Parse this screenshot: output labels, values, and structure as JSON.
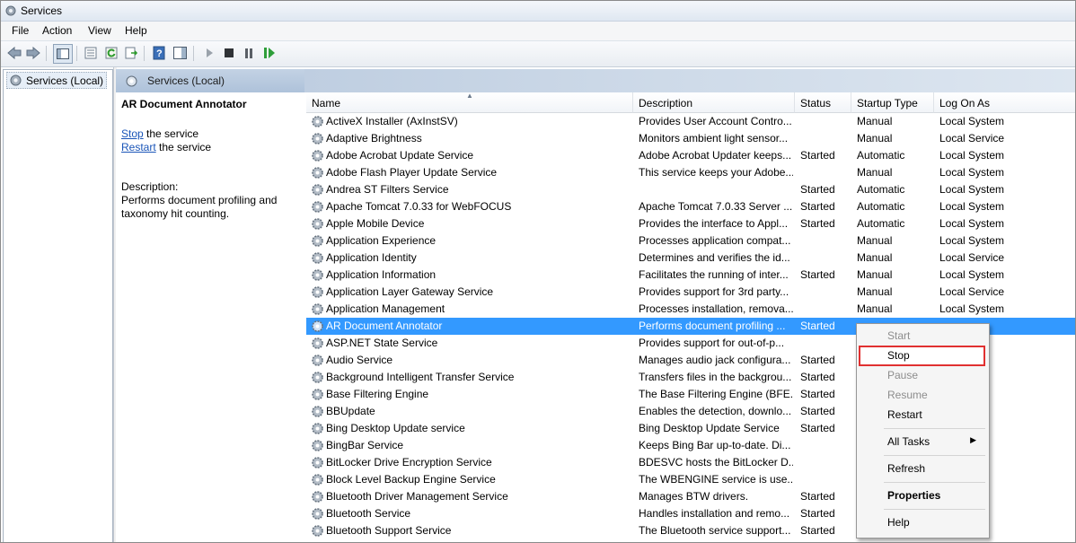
{
  "window": {
    "title": "Services"
  },
  "menu": [
    "File",
    "Action",
    "View",
    "Help"
  ],
  "toolbar": {
    "icons": [
      "back-arrow-icon",
      "forward-arrow-icon",
      "console-tree-icon",
      "properties-icon",
      "refresh-icon",
      "export-list-icon",
      "help-icon",
      "show-hide-action-pane-icon",
      "start-service-icon",
      "stop-service-icon",
      "pause-service-icon",
      "restart-service-icon"
    ]
  },
  "tree": {
    "item": "Services (Local)"
  },
  "pane": {
    "title": "Services (Local)"
  },
  "details": {
    "service_name": "AR Document Annotator",
    "stop_link": "Stop",
    "stop_suffix": " the service",
    "restart_link": "Restart",
    "restart_suffix": " the service",
    "description_label": "Description:",
    "description_text": "Performs document profiling and taxonomy hit counting."
  },
  "columns": [
    "Name",
    "Description",
    "Status",
    "Startup Type",
    "Log On As"
  ],
  "services": [
    {
      "name": "ActiveX Installer (AxInstSV)",
      "description": "Provides User Account Contro...",
      "status": "",
      "startup": "Manual",
      "logon": "Local System"
    },
    {
      "name": "Adaptive Brightness",
      "description": "Monitors ambient light sensor...",
      "status": "",
      "startup": "Manual",
      "logon": "Local Service"
    },
    {
      "name": "Adobe Acrobat Update Service",
      "description": "Adobe Acrobat Updater keeps...",
      "status": "Started",
      "startup": "Automatic",
      "logon": "Local System"
    },
    {
      "name": "Adobe Flash Player Update Service",
      "description": "This service keeps your Adobe...",
      "status": "",
      "startup": "Manual",
      "logon": "Local System"
    },
    {
      "name": "Andrea ST Filters Service",
      "description": "",
      "status": "Started",
      "startup": "Automatic",
      "logon": "Local System"
    },
    {
      "name": "Apache Tomcat 7.0.33 for WebFOCUS",
      "description": "Apache Tomcat 7.0.33 Server ...",
      "status": "Started",
      "startup": "Automatic",
      "logon": "Local System"
    },
    {
      "name": "Apple Mobile Device",
      "description": "Provides the interface to Appl...",
      "status": "Started",
      "startup": "Automatic",
      "logon": "Local System"
    },
    {
      "name": "Application Experience",
      "description": "Processes application compat...",
      "status": "",
      "startup": "Manual",
      "logon": "Local System"
    },
    {
      "name": "Application Identity",
      "description": "Determines and verifies the id...",
      "status": "",
      "startup": "Manual",
      "logon": "Local Service"
    },
    {
      "name": "Application Information",
      "description": "Facilitates the running of inter...",
      "status": "Started",
      "startup": "Manual",
      "logon": "Local System"
    },
    {
      "name": "Application Layer Gateway Service",
      "description": "Provides support for 3rd party...",
      "status": "",
      "startup": "Manual",
      "logon": "Local Service"
    },
    {
      "name": "Application Management",
      "description": "Processes installation, remova...",
      "status": "",
      "startup": "Manual",
      "logon": "Local System"
    },
    {
      "name": "AR Document Annotator",
      "description": "Performs document profiling ...",
      "status": "Started",
      "startup": "",
      "logon": "em",
      "selected": true
    },
    {
      "name": "ASP.NET State Service",
      "description": "Provides support for out-of-p...",
      "status": "",
      "startup": "",
      "logon": "ervice"
    },
    {
      "name": "Audio Service",
      "description": "Manages audio jack configura...",
      "status": "Started",
      "startup": "",
      "logon": "em"
    },
    {
      "name": "Background Intelligent Transfer Service",
      "description": "Transfers files in the backgrou...",
      "status": "Started",
      "startup": "",
      "logon": "em"
    },
    {
      "name": "Base Filtering Engine",
      "description": "The Base Filtering Engine (BFE...",
      "status": "Started",
      "startup": "",
      "logon": "ce"
    },
    {
      "name": "BBUpdate",
      "description": "Enables the detection, downlo...",
      "status": "Started",
      "startup": "",
      "logon": "em"
    },
    {
      "name": "Bing Desktop Update service",
      "description": "Bing Desktop Update Service",
      "status": "Started",
      "startup": "",
      "logon": "em"
    },
    {
      "name": "BingBar Service",
      "description": "Keeps Bing Bar up-to-date. Di...",
      "status": "",
      "startup": "",
      "logon": "em"
    },
    {
      "name": "BitLocker Drive Encryption Service",
      "description": "BDESVC hosts the BitLocker D...",
      "status": "",
      "startup": "",
      "logon": "em"
    },
    {
      "name": "Block Level Backup Engine Service",
      "description": "The WBENGINE service is use...",
      "status": "",
      "startup": "",
      "logon": "em"
    },
    {
      "name": "Bluetooth Driver Management Service",
      "description": "Manages BTW drivers.",
      "status": "Started",
      "startup": "",
      "logon": "em"
    },
    {
      "name": "Bluetooth Service",
      "description": "Handles installation and remo...",
      "status": "Started",
      "startup": "",
      "logon": "em"
    },
    {
      "name": "Bluetooth Support Service",
      "description": "The Bluetooth service support...",
      "status": "Started",
      "startup": "",
      "logon": "em"
    }
  ],
  "context_menu": {
    "start": "Start",
    "stop": "Stop",
    "pause": "Pause",
    "resume": "Resume",
    "restart": "Restart",
    "all_tasks": "All Tasks",
    "refresh": "Refresh",
    "properties": "Properties",
    "help": "Help"
  },
  "colors": {
    "selection": "#3399ff",
    "link": "#1a55b8",
    "highlight_border": "#e03030"
  }
}
